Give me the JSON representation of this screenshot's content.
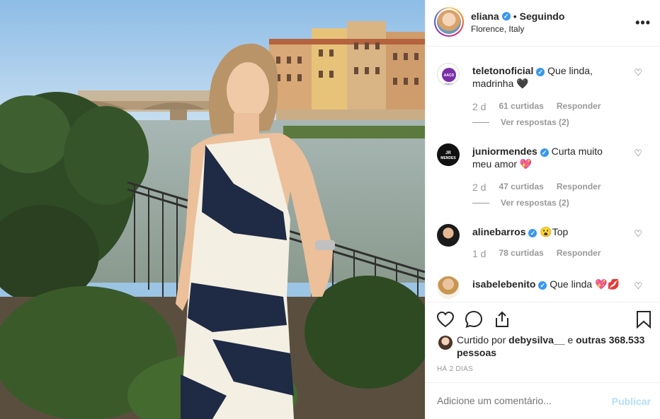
{
  "post": {
    "username": "eliana",
    "follow_status": "Seguindo",
    "separator": "•",
    "location": "Florence, Italy",
    "more_icon": "more-horizontal-icon"
  },
  "comments": [
    {
      "user": "teletonoficial",
      "text": "Que linda, madrinha 🖤",
      "time": "2 d",
      "likes": "61 curtidas",
      "reply": "Responder",
      "view_replies": "Ver respostas (2)",
      "avatar_label": "AACD teleton"
    },
    {
      "user": "juniormendes",
      "text": "Curta muito meu amor 💖",
      "time": "2 d",
      "likes": "47 curtidas",
      "reply": "Responder",
      "view_replies": "Ver respostas (2)",
      "avatar_label": "JR MENDES"
    },
    {
      "user": "alinebarros",
      "text": "😮Top",
      "time": "1 d",
      "likes": "78 curtidas",
      "reply": "Responder"
    },
    {
      "user": "isabelebenito",
      "text": "Que linda 💖💋"
    }
  ],
  "liked": {
    "prefix": "Curtido por",
    "user": "debysilva__",
    "conj": "e",
    "others": "outras 368.533 pessoas"
  },
  "time_ago": "HÁ 2 DIAS",
  "add_comment": {
    "placeholder": "Adicione um comentário...",
    "publish": "Publicar"
  },
  "colors": {
    "verified": "#3897f0",
    "publish_disabled": "#b2dffc",
    "meta_gray": "#999999",
    "teleton_purple": "#7b2ea6"
  }
}
